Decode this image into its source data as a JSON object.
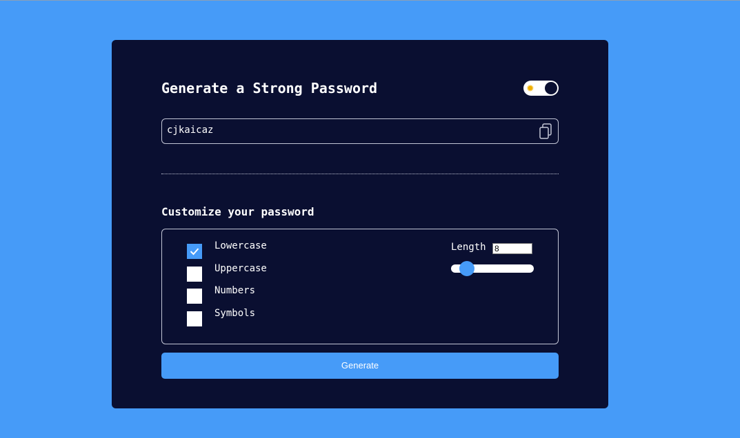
{
  "header": {
    "title": "Generate a Strong Password",
    "theme_toggle": {
      "icon": "sun-icon",
      "sun_glyph": "✹",
      "state": "dark"
    }
  },
  "password": {
    "value": "cjkaicaz",
    "copy_icon": "copy-icon"
  },
  "customize": {
    "title": "Customize your password",
    "options": [
      {
        "label": "Lowercase",
        "checked": true
      },
      {
        "label": "Uppercase",
        "checked": false
      },
      {
        "label": "Numbers",
        "checked": false
      },
      {
        "label": "Symbols",
        "checked": false
      }
    ],
    "length": {
      "label": "Length",
      "value": "8",
      "slider_fraction": 0.12
    }
  },
  "generate_button": {
    "label": "Generate"
  },
  "colors": {
    "background": "#469bf8",
    "card": "#0a0f31",
    "accent": "#469bf8",
    "text": "#ffffff"
  }
}
